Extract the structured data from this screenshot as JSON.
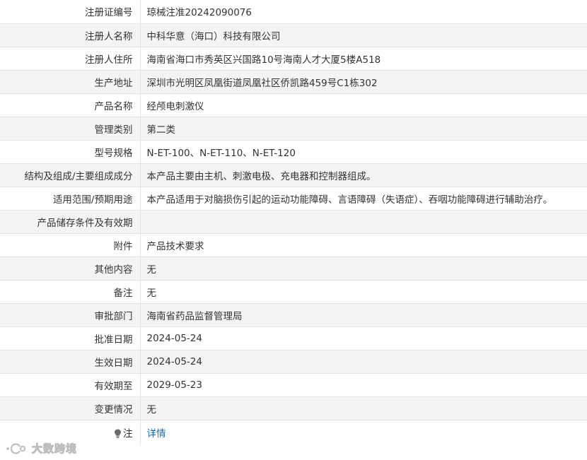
{
  "rows": [
    {
      "label": "注册证编号",
      "value": "琼械注准20242090076"
    },
    {
      "label": "注册人名称",
      "value": "中科华意（海口）科技有限公司"
    },
    {
      "label": "注册人住所",
      "value": "海南省海口市秀英区兴国路10号海南人才大厦5楼A518"
    },
    {
      "label": "生产地址",
      "value": "深圳市光明区凤凰街道凤凰社区侨凯路459号C1栋302"
    },
    {
      "label": "产品名称",
      "value": "经颅电刺激仪"
    },
    {
      "label": "管理类别",
      "value": "第二类"
    },
    {
      "label": "型号规格",
      "value": "N-ET-100、N-ET-110、N-ET-120"
    },
    {
      "label": "结构及组成/主要组成成分",
      "value": "本产品主要由主机、刺激电极、充电器和控制器组成。"
    },
    {
      "label": "适用范围/预期用途",
      "value": "本产品适用于对脑损伤引起的运动功能障碍、言语障碍（失语症）、吞咽功能障碍进行辅助治疗。"
    },
    {
      "label": "产品储存条件及有效期",
      "value": ""
    },
    {
      "label": "附件",
      "value": "产品技术要求"
    },
    {
      "label": "其他内容",
      "value": "无"
    },
    {
      "label": "备注",
      "value": "无"
    },
    {
      "label": "审批部门",
      "value": "海南省药品监督管理局"
    },
    {
      "label": "批准日期",
      "value": "2024-05-24"
    },
    {
      "label": "生效日期",
      "value": "2024-05-24"
    },
    {
      "label": "有效期至",
      "value": "2029-05-23"
    },
    {
      "label": "变更情况",
      "value": "无"
    }
  ],
  "note": {
    "label": "注",
    "link_text": "详情",
    "icon": "lightbulb-icon"
  },
  "watermark": {
    "text": "大数跨境",
    "icon": "brand-logo-icon"
  },
  "colors": {
    "link": "#1a6fc4",
    "stripe": "#f4f4f4",
    "border": "#e3e3e3",
    "text": "#333333"
  }
}
